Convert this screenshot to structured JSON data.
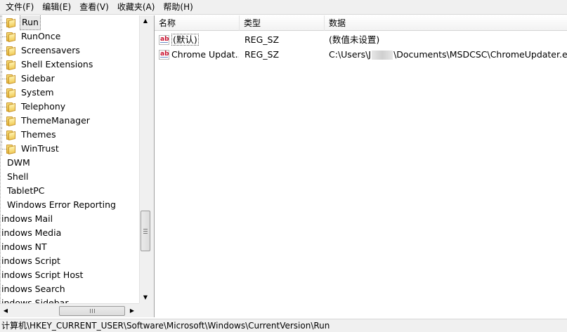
{
  "menu": [
    {
      "label": "文件(F)"
    },
    {
      "label": "编辑(E)"
    },
    {
      "label": "查看(V)"
    },
    {
      "label": "收藏夹(A)"
    },
    {
      "label": "帮助(H)"
    }
  ],
  "tree": {
    "child_items": [
      {
        "label": "Run",
        "selected": true
      },
      {
        "label": "RunOnce"
      },
      {
        "label": "Screensavers"
      },
      {
        "label": "Shell Extensions"
      },
      {
        "label": "Sidebar"
      },
      {
        "label": "System"
      },
      {
        "label": "Telephony"
      },
      {
        "label": "ThemeManager"
      },
      {
        "label": "Themes"
      },
      {
        "label": "WinTrust"
      }
    ],
    "sibling_items": [
      {
        "label": "DWM"
      },
      {
        "label": "Shell"
      },
      {
        "label": "TabletPC"
      },
      {
        "label": "Windows Error Reporting"
      },
      {
        "label": "indows Mail"
      },
      {
        "label": "indows Media"
      },
      {
        "label": "indows NT"
      },
      {
        "label": "indows Script"
      },
      {
        "label": "indows Script Host"
      },
      {
        "label": "indows Search"
      },
      {
        "label": "indows Sidebar"
      }
    ]
  },
  "list": {
    "columns": {
      "name": "名称",
      "type": "类型",
      "data": "数据"
    },
    "rows": [
      {
        "icon": "ab-string-icon",
        "icon_text": "ab",
        "name": "(默认)",
        "type": "REG_SZ",
        "data": "(数值未设置)"
      },
      {
        "icon": "ab-string-icon",
        "icon_text": "ab",
        "name": "Chrome Updat...",
        "type": "REG_SZ",
        "data_prefix": "C:\\Users\\",
        "data_initial": "J",
        "data_suffix": "\\Documents\\MSDCSC\\ChromeUpdater.exe"
      }
    ]
  },
  "statusbar": {
    "path": "计算机\\HKEY_CURRENT_USER\\Software\\Microsoft\\Windows\\CurrentVersion\\Run"
  },
  "scroll": {
    "up_arrow": "▲",
    "down_arrow": "▼",
    "left_arrow": "◀",
    "right_arrow": "▶"
  }
}
